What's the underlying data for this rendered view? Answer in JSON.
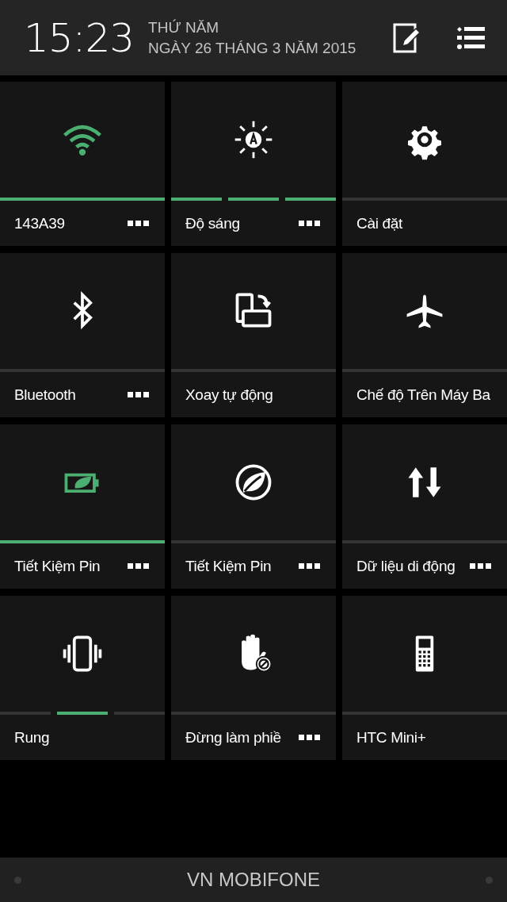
{
  "header": {
    "time": "15:23",
    "weekday": "THỨ NĂM",
    "date": "NGÀY 26 THÁNG 3 NĂM 2015"
  },
  "tiles": [
    {
      "label": "143A39",
      "kind": "toggle",
      "on": true,
      "menu": true
    },
    {
      "label": "Độ sáng",
      "kind": "segmented",
      "segments": [
        {
          "on": true
        },
        {
          "on": true
        },
        {
          "on": true
        }
      ],
      "menu": true
    },
    {
      "label": "Cài đặt",
      "kind": "toggle",
      "on": false,
      "menu": false
    },
    {
      "label": "Bluetooth",
      "kind": "toggle",
      "on": false,
      "menu": true
    },
    {
      "label": "Xoay tự động",
      "kind": "toggle",
      "on": false,
      "menu": false
    },
    {
      "label": "Chế độ Trên Máy Ba",
      "kind": "toggle",
      "on": false,
      "menu": false
    },
    {
      "label": "Tiết Kiệm Pin",
      "kind": "toggle",
      "on": true,
      "menu": true
    },
    {
      "label": "Tiết Kiệm Pin",
      "kind": "toggle",
      "on": false,
      "menu": true
    },
    {
      "label": "Dữ liệu di động",
      "kind": "toggle",
      "on": false,
      "menu": true
    },
    {
      "label": "Rung",
      "kind": "segmented",
      "segments": [
        {
          "on": false
        },
        {
          "on": true
        },
        {
          "on": false
        }
      ],
      "menu": false
    },
    {
      "label": "Đừng làm phiề",
      "kind": "toggle",
      "on": false,
      "menu": true
    },
    {
      "label": "HTC Mini+",
      "kind": "toggle",
      "on": false,
      "menu": false
    }
  ],
  "footer": {
    "carrier": "VN MOBIFONE"
  }
}
